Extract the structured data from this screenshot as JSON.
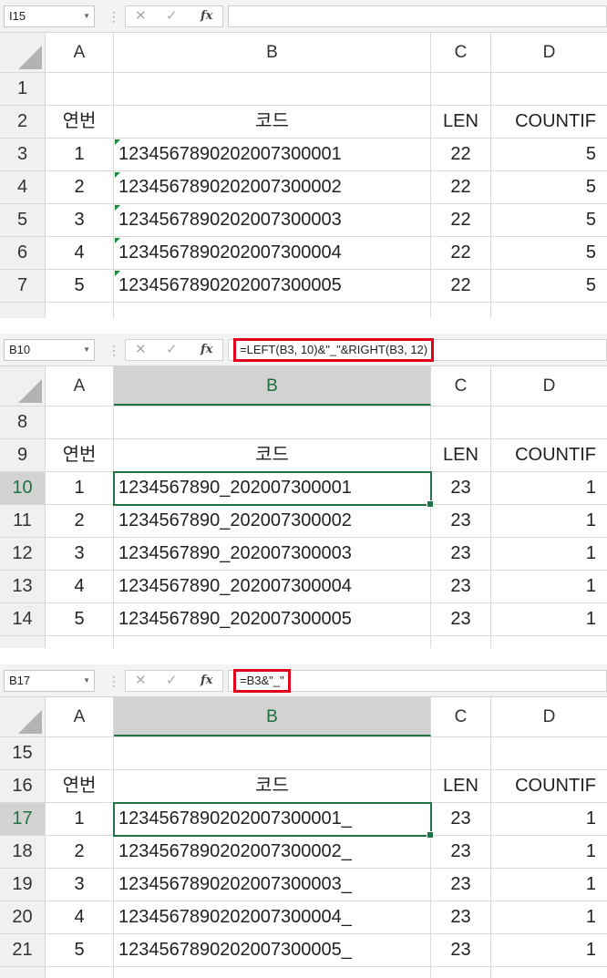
{
  "headers": {
    "corner": "",
    "a": "A",
    "b": "B",
    "c": "C",
    "d": "D"
  },
  "panels": [
    {
      "namebox": "I15",
      "formula": "",
      "highlight": false,
      "rows": [
        {
          "n": "1",
          "a": "",
          "b": "",
          "c": "",
          "d": ""
        },
        {
          "n": "2",
          "a": "연번",
          "b": "코드",
          "c": "LEN",
          "d": "COUNTIF"
        },
        {
          "n": "3",
          "a": "1",
          "b": "1234567890202007300001",
          "c": "22",
          "d": "5"
        },
        {
          "n": "4",
          "a": "2",
          "b": "1234567890202007300002",
          "c": "22",
          "d": "5"
        },
        {
          "n": "5",
          "a": "3",
          "b": "1234567890202007300003",
          "c": "22",
          "d": "5"
        },
        {
          "n": "6",
          "a": "4",
          "b": "1234567890202007300004",
          "c": "22",
          "d": "5"
        },
        {
          "n": "7",
          "a": "5",
          "b": "1234567890202007300005",
          "c": "22",
          "d": "5"
        }
      ]
    },
    {
      "namebox": "B10",
      "formula": "=LEFT(B3, 10)&\"_\"&RIGHT(B3, 12)",
      "highlight": true,
      "rows": [
        {
          "n": "8",
          "a": "",
          "b": "",
          "c": "",
          "d": ""
        },
        {
          "n": "9",
          "a": "연번",
          "b": "코드",
          "c": "LEN",
          "d": "COUNTIF"
        },
        {
          "n": "10",
          "a": "1",
          "b": "1234567890_202007300001",
          "c": "23",
          "d": "1"
        },
        {
          "n": "11",
          "a": "2",
          "b": "1234567890_202007300002",
          "c": "23",
          "d": "1"
        },
        {
          "n": "12",
          "a": "3",
          "b": "1234567890_202007300003",
          "c": "23",
          "d": "1"
        },
        {
          "n": "13",
          "a": "4",
          "b": "1234567890_202007300004",
          "c": "23",
          "d": "1"
        },
        {
          "n": "14",
          "a": "5",
          "b": "1234567890_202007300005",
          "c": "23",
          "d": "1"
        }
      ]
    },
    {
      "namebox": "B17",
      "formula": "=B3&\"_\"",
      "highlight": true,
      "rows": [
        {
          "n": "15",
          "a": "",
          "b": "",
          "c": "",
          "d": ""
        },
        {
          "n": "16",
          "a": "연번",
          "b": "코드",
          "c": "LEN",
          "d": "COUNTIF"
        },
        {
          "n": "17",
          "a": "1",
          "b": "1234567890202007300001_",
          "c": "23",
          "d": "1"
        },
        {
          "n": "18",
          "a": "2",
          "b": "1234567890202007300002_",
          "c": "23",
          "d": "1"
        },
        {
          "n": "19",
          "a": "3",
          "b": "1234567890202007300003_",
          "c": "23",
          "d": "1"
        },
        {
          "n": "20",
          "a": "4",
          "b": "1234567890202007300004_",
          "c": "23",
          "d": "1"
        },
        {
          "n": "21",
          "a": "5",
          "b": "1234567890202007300005_",
          "c": "23",
          "d": "1"
        }
      ]
    }
  ],
  "icons": {
    "dropdown": "chevron-down-icon",
    "cancel": "cancel-icon",
    "enter": "checkmark-icon",
    "fx": "fx-icon"
  },
  "colors": {
    "selection": "#217346",
    "highlight": "#e0001b",
    "error_indicator": "#1a8f3a"
  }
}
